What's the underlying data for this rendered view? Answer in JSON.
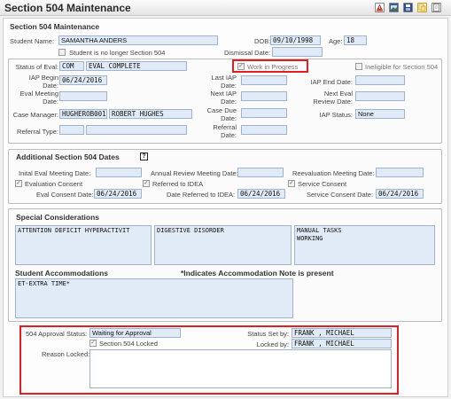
{
  "header": {
    "title": "Section 504 Maintenance"
  },
  "toolbar": {
    "icons": [
      "warning-icon",
      "image-icon",
      "save-icon",
      "copy-icon",
      "document-icon"
    ],
    "colors": [
      "#d23b2b",
      "#3b5f8f",
      "#2b4c8c",
      "#c9a227",
      "#6f6f6f"
    ]
  },
  "maintenance": {
    "section_title": "Section 504 Maintenance",
    "student_name_label": "Student Name:",
    "student_name": "SAMANTHA ANDERS",
    "dob_label": "DOB:",
    "dob": "09/10/1998",
    "age_label": "Age:",
    "age": "18",
    "no_longer_label": "Student is no longer Section 504",
    "dismissal_date_label": "Dismissal Date:",
    "dismissal_date": ""
  },
  "eval": {
    "status_label": "Status of Eval:",
    "status_code": "COM",
    "status_text": "EVAL COMPLETE",
    "work_in_progress_label": "Work in Progress",
    "ineligible_label": "Ineligible for Section 504",
    "iap_begin_label_1": "IAP Begin",
    "iap_begin_label_2": "Date:",
    "iap_begin_date": "06/24/2016",
    "last_iap_label_1": "Last IAP",
    "last_iap_label_2": "Date:",
    "last_iap_date": "",
    "iap_end_label": "IAP End Date:",
    "iap_end_date": "",
    "eval_meeting_label_1": "Eval Meeting",
    "eval_meeting_label_2": "Date:",
    "eval_meeting_date": "",
    "next_iap_label_1": "Next IAP",
    "next_iap_label_2": "Date:",
    "next_iap_date": "",
    "next_eval_label_1": "Next Eval",
    "next_eval_label_2": "Review Date:",
    "next_eval_date": "",
    "case_manager_label": "Case Manager:",
    "case_manager_code": "HUGHEROB001",
    "case_manager_name": "ROBERT HUGHES",
    "case_due_label_1": "Case Due",
    "case_due_label_2": "Date:",
    "case_due_date": "",
    "iap_status_label": "IAP Status:",
    "iap_status": "None",
    "referral_type_label": "Referral Type:",
    "referral_type_code": "",
    "referral_type_text": "",
    "referral_label_1": "Referral",
    "referral_label_2": "Date:",
    "referral_date": ""
  },
  "additional": {
    "title": "Additional Section 504 Dates",
    "help": "?",
    "initial_eval_label": "Inital Eval Meeting Date:",
    "initial_eval_date": "",
    "annual_review_label": "Annual Review Meeting Date:",
    "annual_review_date": "",
    "reevaluation_label": "Reevaluation Meeting Date:",
    "reevaluation_date": "",
    "evaluation_consent_label": "Evaluation Consent",
    "referred_idea_label": "Referred to IDEA",
    "service_consent_label": "Service Consent",
    "eval_consent_date_label": "Eval Consent Date:",
    "eval_consent_date": "06/24/2016",
    "date_referred_label": "Date Referred to IDEA:",
    "date_referred": "06/24/2016",
    "service_consent_date_label": "Service Consent Date:",
    "service_consent_date": "06/24/2016"
  },
  "special": {
    "title": "Special Considerations",
    "consideration_1": "ATTENTION DEFICIT HYPERACTIVIT",
    "consideration_2": "DIGESTIVE DISORDER",
    "consideration_3": "MANUAL TASKS\nWORKING",
    "accommodations_title": "Student Accommodations",
    "accommodation_note": "*Indicates Accommodation Note is present",
    "accommodations": "ET-EXTRA TIME*"
  },
  "approval": {
    "status_label": "504 Approval Status:",
    "status": "Waiting for Approval",
    "locked_label": "Section 504 Locked",
    "reason_label": "Reason Locked:",
    "reason": "",
    "status_set_by_label": "Status Set by:",
    "status_set_by": "FRANK , MICHAEL",
    "locked_by_label": "Locked by:",
    "locked_by": "FRANK , MICHAEL"
  }
}
